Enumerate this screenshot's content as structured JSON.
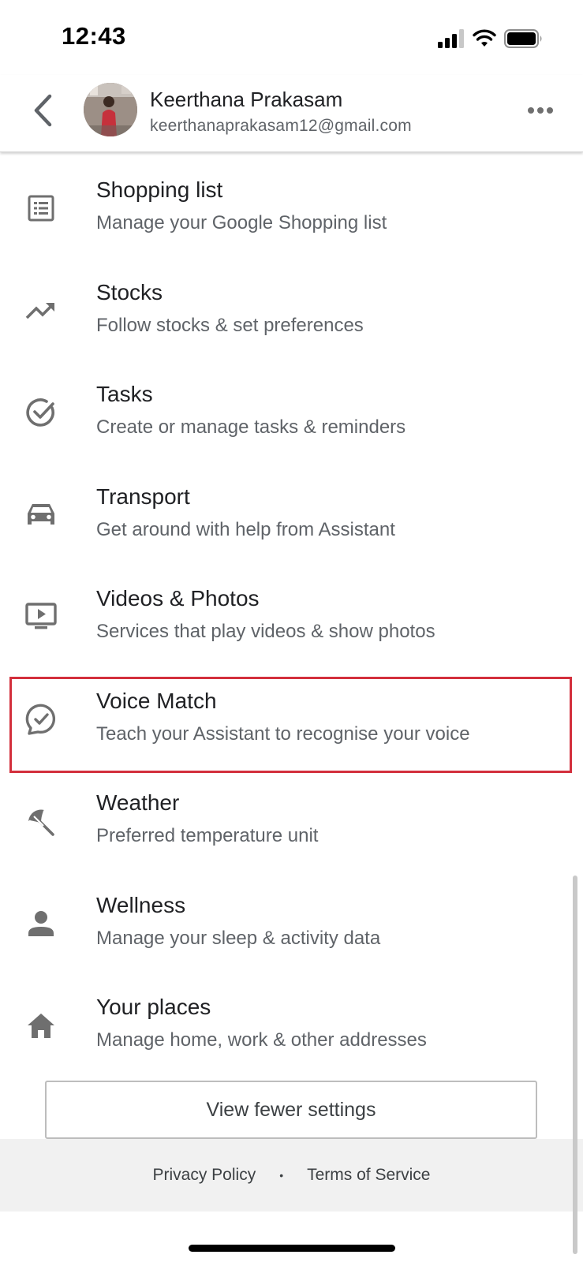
{
  "status_bar": {
    "time": "12:43",
    "icons": [
      "signal-icon",
      "wifi-icon",
      "battery-icon"
    ]
  },
  "header": {
    "back_icon": "chevron-left-icon",
    "account_name": "Keerthana Prakasam",
    "account_email": "keerthanaprakasam12@gmail.com",
    "more_icon": "more-horizontal-icon"
  },
  "settings": [
    {
      "icon": "list-icon",
      "title": "Shopping list",
      "subtitle": "Manage your Google Shopping list"
    },
    {
      "icon": "trending-up-icon",
      "title": "Stocks",
      "subtitle": "Follow stocks & set preferences"
    },
    {
      "icon": "check-circle-icon",
      "title": "Tasks",
      "subtitle": "Create or manage tasks & reminders"
    },
    {
      "icon": "car-icon",
      "title": "Transport",
      "subtitle": "Get around with help from Assistant"
    },
    {
      "icon": "tv-play-icon",
      "title": "Videos & Photos",
      "subtitle": "Services that play videos & show photos"
    },
    {
      "icon": "voice-check-icon",
      "title": "Voice Match",
      "subtitle": "Teach your Assistant to recognise your voice"
    },
    {
      "icon": "beach-umbrella-icon",
      "title": "Weather",
      "subtitle": "Preferred temperature unit"
    },
    {
      "icon": "person-icon",
      "title": "Wellness",
      "subtitle": "Manage your sleep & activity data"
    },
    {
      "icon": "home-icon",
      "title": "Your places",
      "subtitle": "Manage home, work & other addresses"
    }
  ],
  "view_fewer_label": "View fewer settings",
  "footer": {
    "privacy_label": "Privacy Policy",
    "separator": "•",
    "terms_label": "Terms of Service"
  },
  "colors": {
    "highlight": "#d32f3c",
    "icon_gray": "#6f6f6f",
    "footer_bg": "#f1f1f1"
  }
}
